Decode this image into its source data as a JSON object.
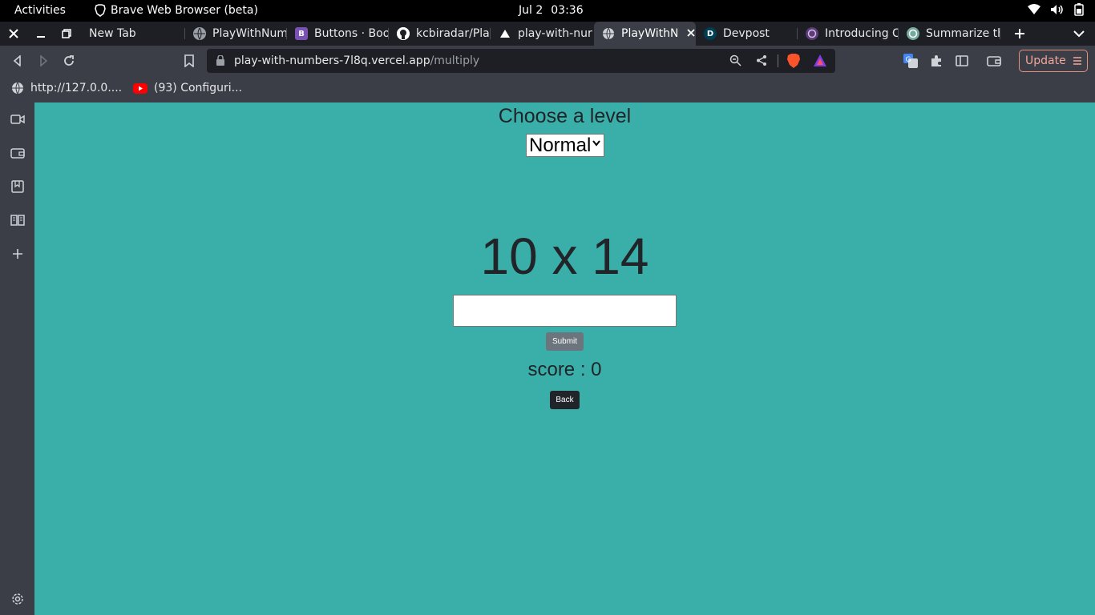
{
  "system_bar": {
    "activities": "Activities",
    "app_name": "Brave Web Browser (beta)",
    "date": "Jul 2",
    "time": "03:36",
    "tray_icons": [
      "wifi-icon",
      "volume-icon",
      "battery-icon"
    ]
  },
  "tabs": [
    {
      "title": "New Tab",
      "favicon": "none"
    },
    {
      "title": "PlayWithNum",
      "favicon": "globe-icon"
    },
    {
      "title": "Buttons · Boo",
      "favicon": "bootstrap-icon"
    },
    {
      "title": "kcbiradar/Pla",
      "favicon": "github-icon"
    },
    {
      "title": "play-with-nur",
      "favicon": "vercel-icon"
    },
    {
      "title": "PlayWithN",
      "favicon": "globe-icon",
      "active": true
    },
    {
      "title": "Devpost",
      "favicon": "devpost-icon"
    },
    {
      "title": "Introducing C",
      "favicon": "openai-icon"
    },
    {
      "title": "Summarize th",
      "favicon": "chatgpt-icon"
    }
  ],
  "toolbar": {
    "url_domain": "play-with-numbers-7l8q.vercel.app",
    "url_path": "/multiply",
    "update_label": "Update"
  },
  "bookmarks": [
    {
      "label": "http://127.0.0....",
      "icon": "globe-icon"
    },
    {
      "label": "(93) Configuri...",
      "icon": "youtube-icon"
    }
  ],
  "page": {
    "level_title": "Choose a level",
    "level_selected": "Normal",
    "problem": "10 x 14",
    "answer_value": "",
    "submit_label": "Submit",
    "score_text": "score : 0",
    "back_label": "Back"
  },
  "colors": {
    "page_bg": "#3aafa9",
    "text": "#212529",
    "submit_bg": "#6c757d",
    "back_bg": "#212529",
    "browser_chrome": "#3b3e47"
  }
}
